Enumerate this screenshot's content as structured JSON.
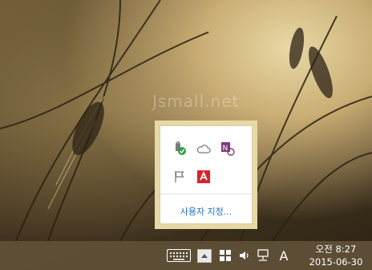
{
  "watermark": "Jsmall.net",
  "overflow_popup": {
    "icons": [
      "usb-safe-remove-icon",
      "onedrive-cloud-icon",
      "onenote-clipper-icon",
      "action-center-flag-icon",
      "avira-antivirus-icon"
    ],
    "customize_label": "사용자 지정..."
  },
  "taskbar": {
    "icons": [
      "touch-keyboard-icon",
      "show-hidden-icons-icon",
      "windows-update-icon",
      "volume-icon",
      "network-icon"
    ],
    "ime_label": "A",
    "clock_time": "오전 8:27",
    "clock_date": "2015-06-30"
  },
  "colors": {
    "popup_frame": "#e8d8a8",
    "link": "#1f6fc2",
    "avira_red": "#d8232a",
    "onenote_purple": "#80397b",
    "check_green": "#2ea043"
  }
}
